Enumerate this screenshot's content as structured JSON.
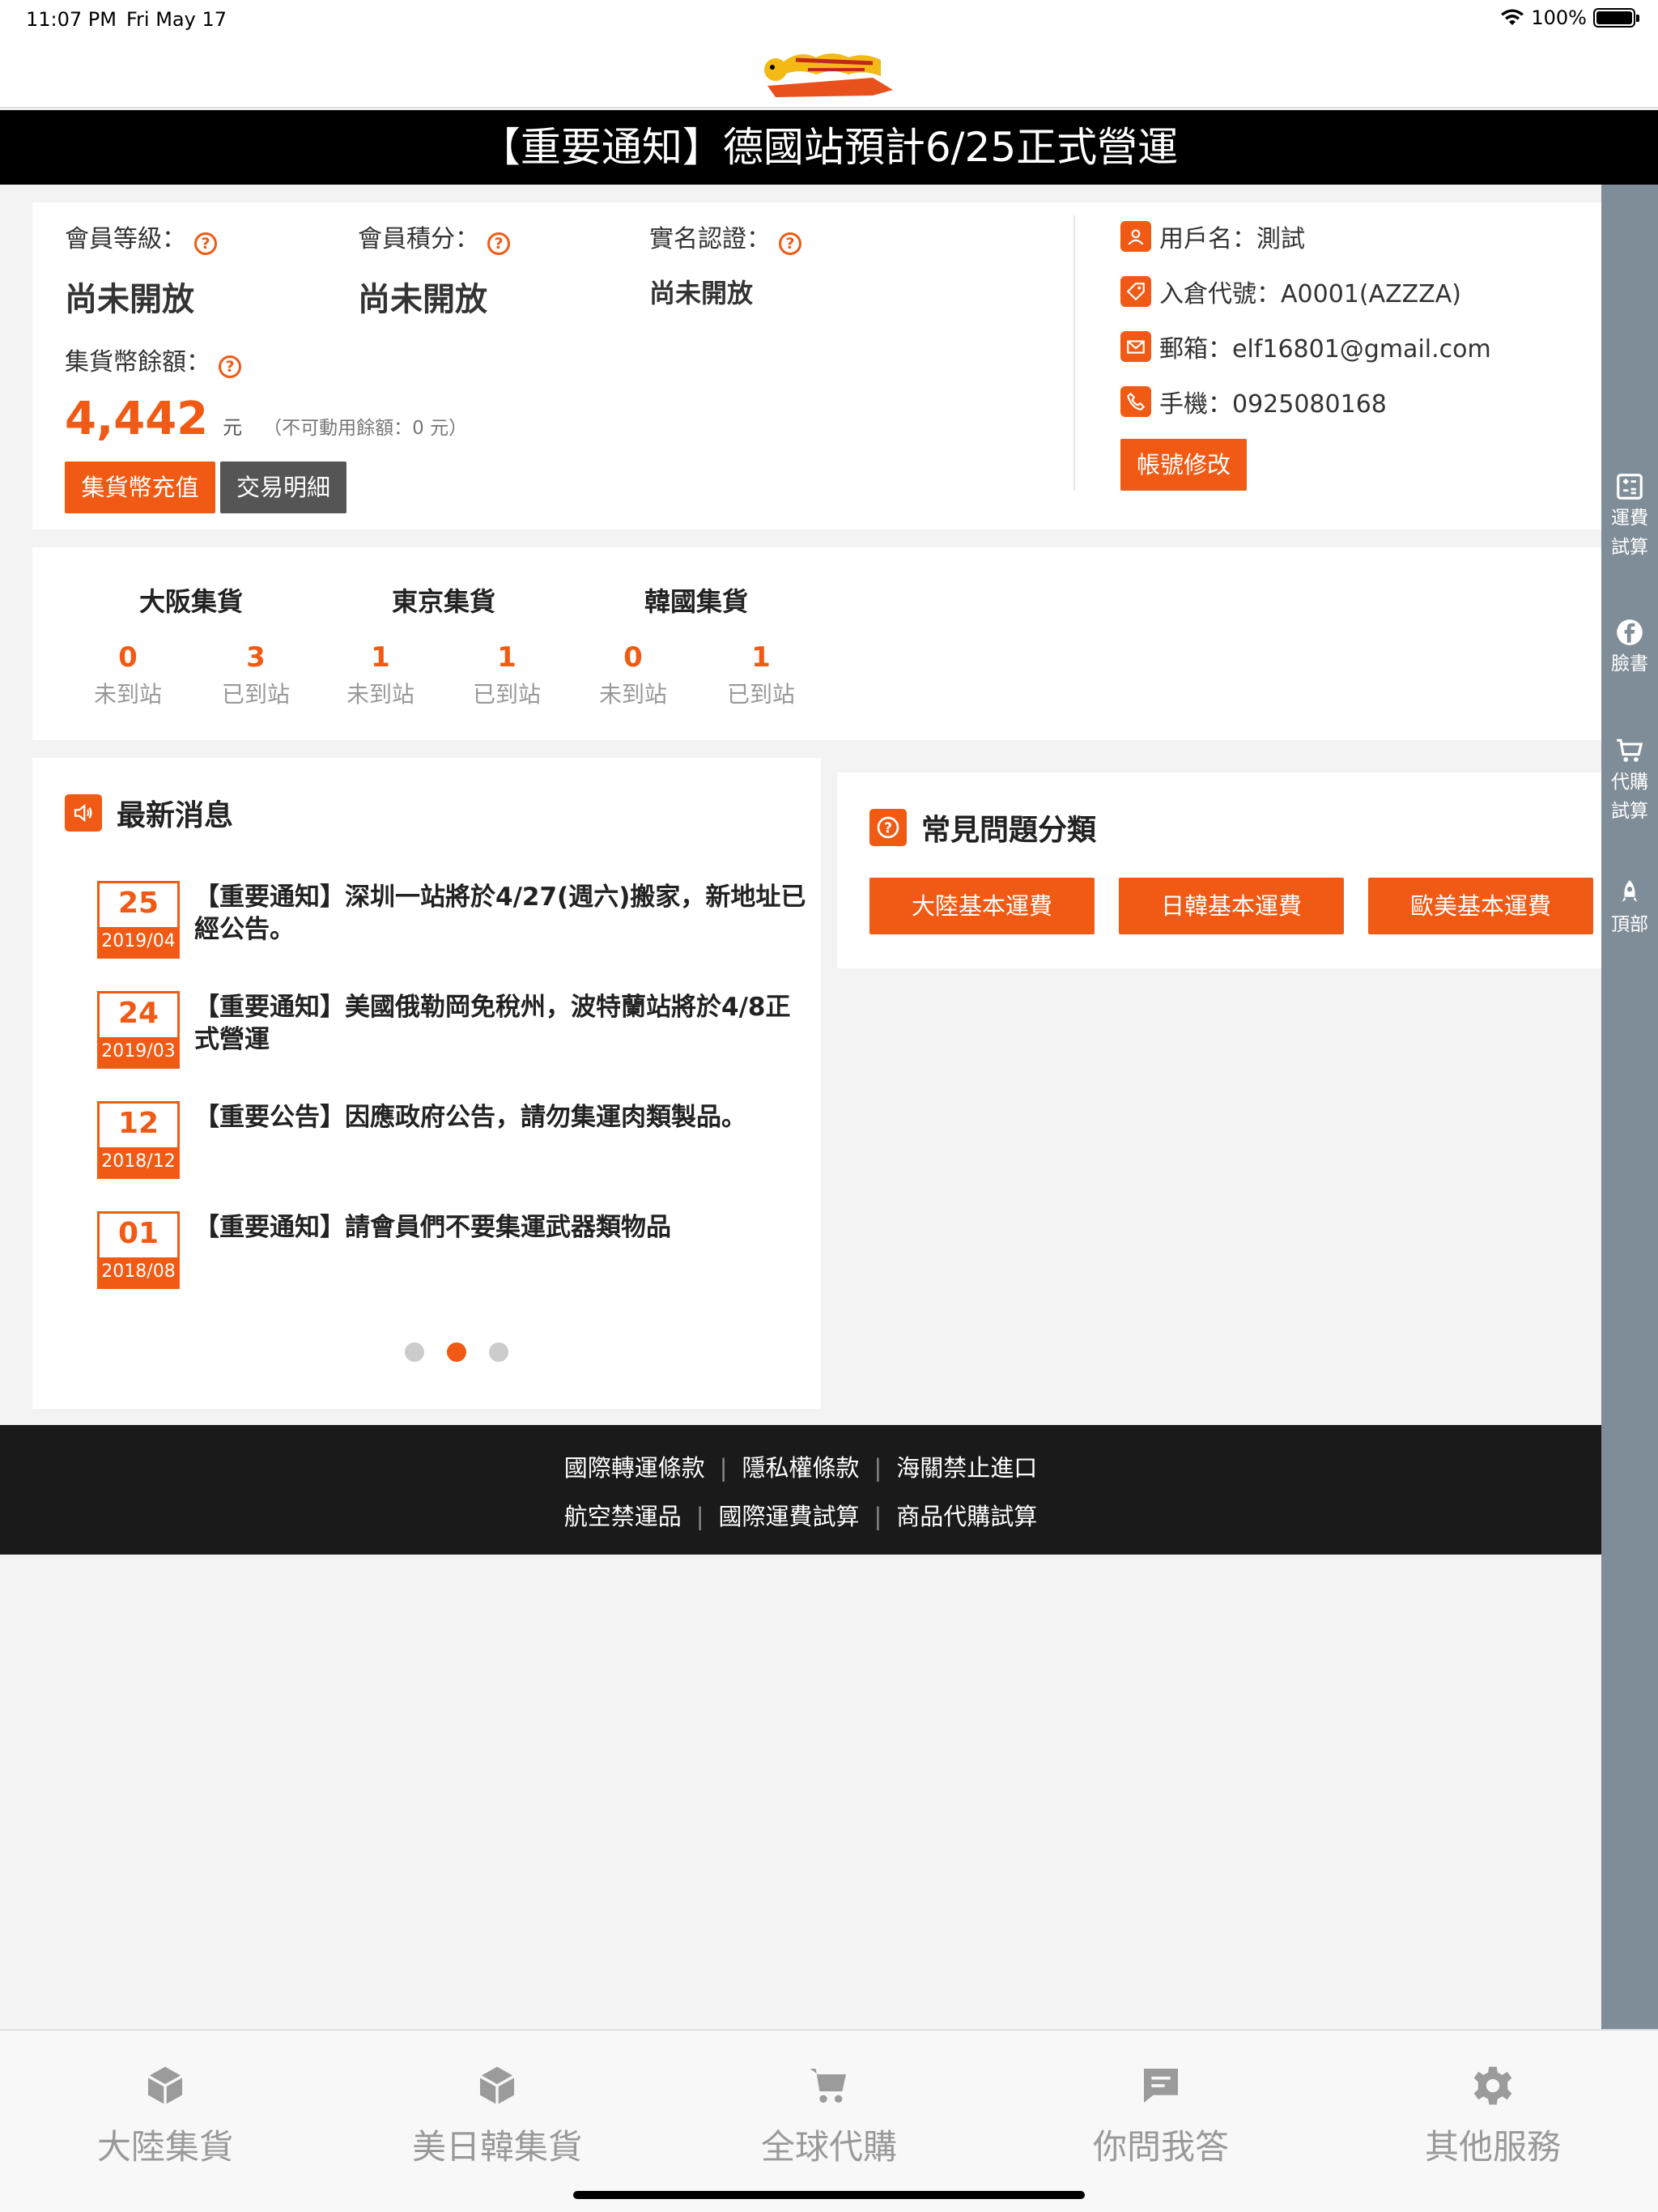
{
  "status": {
    "time": "11:07 PM",
    "date": "Fri May 17",
    "battery": "100%"
  },
  "notice": "【重要通知】德國站預計6/25正式營運",
  "member": {
    "level_label": "會員等級：",
    "level_value": "尚未開放",
    "points_label": "會員積分：",
    "points_value": "尚未開放",
    "verify_label": "實名認證：",
    "verify_value": "尚未開放",
    "balance_label": "集貨幣餘額：",
    "balance_value": "4,442",
    "balance_unit": "元",
    "balance_note": "（不可動用餘額：0 元）",
    "topup_button": "集貨幣充值",
    "transactions_button": "交易明細"
  },
  "user": {
    "username": "用戶名：測試",
    "warehouse_code": "入倉代號：A0001(AZZZA)",
    "email": "郵箱：elf16801@gmail.com",
    "phone": "手機：0925080168",
    "edit_button": "帳號修改"
  },
  "stations": [
    {
      "name": "大阪集貨",
      "not_arrived": "0",
      "arrived": "3"
    },
    {
      "name": "東京集貨",
      "not_arrived": "1",
      "arrived": "1"
    },
    {
      "name": "韓國集貨",
      "not_arrived": "0",
      "arrived": "1"
    }
  ],
  "station_labels": {
    "not_arrived": "未到站",
    "arrived": "已到站"
  },
  "news": {
    "title": "最新消息",
    "items": [
      {
        "day": "25",
        "ym": "2019/04",
        "text": "【重要通知】深圳一站將於4/27(週六)搬家，新地址已經公告。"
      },
      {
        "day": "24",
        "ym": "2019/03",
        "text": "【重要通知】美國俄勒岡免稅州，波特蘭站將於4/8正式營運"
      },
      {
        "day": "12",
        "ym": "2018/12",
        "text": "【重要公告】因應政府公告，請勿集運肉類製品。"
      },
      {
        "day": "01",
        "ym": "2018/08",
        "text": "【重要通知】請會員們不要集運武器類物品"
      }
    ],
    "page_index": 2,
    "page_count": 3
  },
  "faq": {
    "title": "常見問題分類",
    "buttons": [
      "大陸基本運費",
      "日韓基本運費",
      "歐美基本運費"
    ]
  },
  "rail": {
    "items": [
      {
        "label1": "運費",
        "label2": "試算",
        "icon": "calculator-icon"
      },
      {
        "label1": "臉書",
        "label2": "",
        "icon": "facebook-icon"
      },
      {
        "label1": "代購",
        "label2": "試算",
        "icon": "cart-icon"
      },
      {
        "label1": "頂部",
        "label2": "",
        "icon": "rocket-icon"
      }
    ]
  },
  "footer": {
    "row1": [
      "國際轉運條款",
      "隱私權條款",
      "海關禁止進口"
    ],
    "row2": [
      "航空禁運品",
      "國際運費試算",
      "商品代購試算"
    ]
  },
  "tabs": [
    {
      "label": "大陸集貨",
      "icon": "box-icon"
    },
    {
      "label": "美日韓集貨",
      "icon": "box-icon"
    },
    {
      "label": "全球代購",
      "icon": "cart-icon"
    },
    {
      "label": "你問我答",
      "icon": "chat-icon"
    },
    {
      "label": "其他服務",
      "icon": "gear-icon"
    }
  ],
  "colors": {
    "accent": "#f05a14",
    "notice_bg": "#000000",
    "rail_bg": "#7f8d98",
    "footer_bg": "#1a1a1a"
  }
}
